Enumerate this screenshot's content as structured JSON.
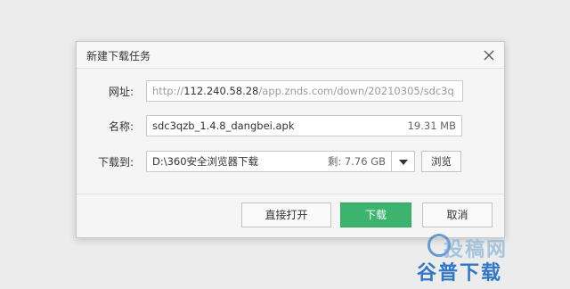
{
  "dialog": {
    "title": "新建下载任务"
  },
  "form": {
    "url_label": "网址:",
    "url_prefix": "http://",
    "url_host": "112.240.58.28",
    "url_path": "/app.znds.com/down/20210305/sdc3q",
    "name_label": "名称:",
    "name_value": "sdc3qzb_1.4.8_dangbei.apk",
    "name_size": "19.31 MB",
    "dir_label": "下载到:",
    "dir_value": "D:\\360安全浏览器下载",
    "dir_free": "剩: 7.76 GB",
    "browse_label": "浏览"
  },
  "footer": {
    "open_label": "直接打开",
    "download_label": "下载",
    "cancel_label": "取消"
  },
  "watermark": {
    "line1": "投稿网",
    "line2": "谷普下载"
  },
  "colors": {
    "primary_green": "#3cb46e",
    "watermark_blue": "#2f77c7"
  }
}
